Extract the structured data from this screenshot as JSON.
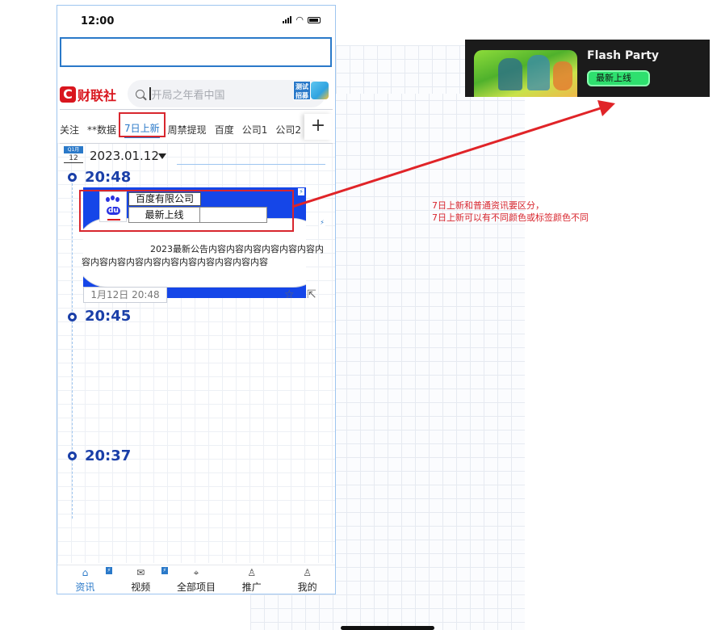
{
  "status_bar": {
    "time": "12:00"
  },
  "header": {
    "logo_mark": "C",
    "logo_text": "财联社",
    "search_placeholder": "开局之年看中国",
    "promo_text": "测试招募"
  },
  "tabs": [
    {
      "label": "关注",
      "active": false
    },
    {
      "label": "**数据",
      "active": false
    },
    {
      "label": "7日上新",
      "active": true
    },
    {
      "label": "周禁提现",
      "active": false
    },
    {
      "label": "百度",
      "active": false
    },
    {
      "label": "公司1",
      "active": false
    },
    {
      "label": "公司2",
      "active": false
    }
  ],
  "add_tab_label": "+",
  "feed": {
    "date_badge_top": "Q1月",
    "date_badge_bottom": "12",
    "date": "2023.01.12",
    "items": [
      {
        "time": "20:48"
      },
      {
        "time": "20:45"
      },
      {
        "time": "20:37"
      }
    ],
    "card": {
      "company": "百度有限公司",
      "tag": "最新上线",
      "logo_text": "du",
      "body_line1": "2023最新公告内容内容内容内容内容内容内",
      "body_line2": "容内容内容内容内容内容内容内容内容内容内容",
      "timestamp": "1月12日 20:48"
    }
  },
  "bottom_nav": [
    {
      "label": "资讯",
      "icon": "home-icon",
      "active": true,
      "badge": true
    },
    {
      "label": "视频",
      "icon": "mail-icon",
      "active": false,
      "badge": true
    },
    {
      "label": "全部项目",
      "icon": "location-icon",
      "active": false,
      "badge": false
    },
    {
      "label": "推广",
      "icon": "user-icon",
      "active": false,
      "badge": false
    },
    {
      "label": "我的",
      "icon": "user-icon",
      "active": false,
      "badge": false
    }
  ],
  "annotation": {
    "line1": "7日上新和普通资讯要区分，",
    "line2": "7日上新可以有不同颜色或标签颜色不同"
  },
  "popup": {
    "title": "Flash Party",
    "tag": "最新上线"
  },
  "colors": {
    "brand_red": "#d9161e",
    "accent_blue": "#2a79c9",
    "timeline_blue": "#1a3fa8",
    "card_blue": "#1546e8",
    "annotation_red": "#d8262e",
    "popup_tag_green": "#2ee06e"
  }
}
